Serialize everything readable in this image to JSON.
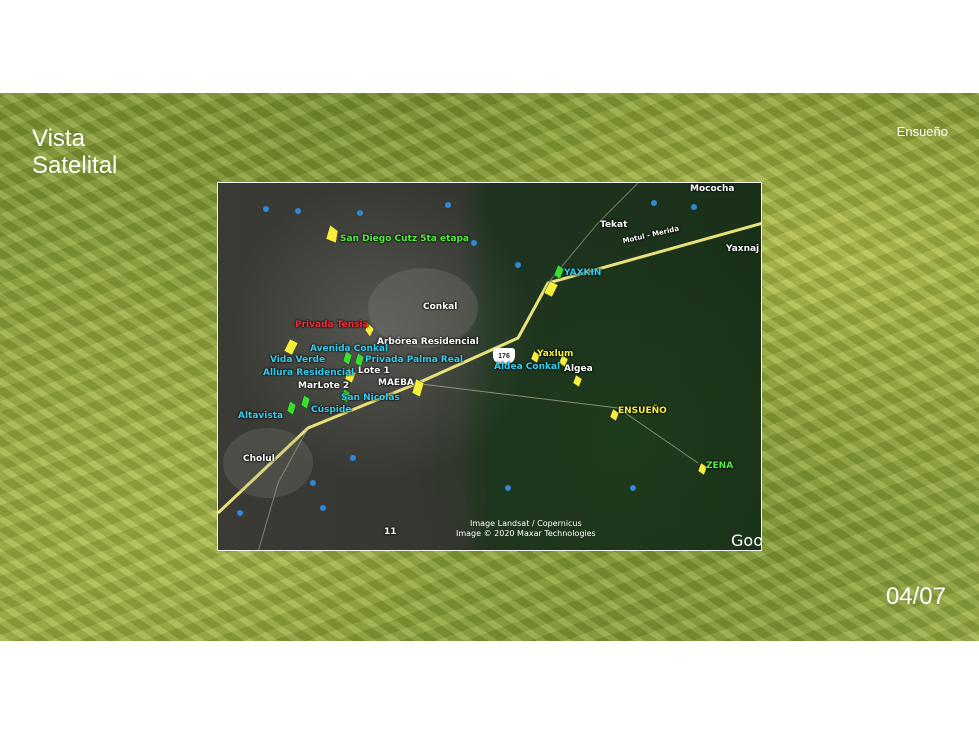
{
  "slide": {
    "title_line1": "Vista",
    "title_line2": "Satelital",
    "project_name": "Ensueño",
    "page_number": "04/07"
  },
  "map": {
    "attribution_line1": "Image Landsat / Copernicus",
    "attribution_line2": "Image © 2020 Maxar Technologies",
    "google_label": "Goo",
    "route_shield": "176",
    "places": {
      "mococha": "Mococha",
      "tekat": "Tekat",
      "motul_merida": "Motul - Merida",
      "yaxnaj": "Yaxnaj",
      "conkal": "Conkal",
      "chol ul": "Cholul",
      "maeba": "MAEBA",
      "route_11": "11"
    },
    "developments": {
      "san_diego": "San Diego Cutz 5ta etapa",
      "yaxkin": "YAXKIN",
      "privada_tensia": "Privada Tensia",
      "arborea": "Arbórea Residencial",
      "avenida_conkal": "Avenida Conkal",
      "vida_verde": "Vida Verde",
      "privada_palma_real": "Privada Palma Real",
      "allura": "Allura Residencial",
      "lote1": "Lote 1",
      "marlote2": "MarLote 2",
      "san_nicolas": "San Nicolás",
      "altavista": "Altavista",
      "cuspide": "Cúspide",
      "yaxlum": "Yaxlum",
      "aldea_conkal": "Aldea Conkal",
      "algea": "Algea",
      "ensueno": "ENSUEÑO",
      "zena": "ZENA"
    }
  },
  "colors": {
    "label_cyan": "#35d0f0",
    "label_green": "#58ef44",
    "label_yellow": "#f5ee3a",
    "label_red": "#f0303a",
    "road": "#e8e07a"
  }
}
